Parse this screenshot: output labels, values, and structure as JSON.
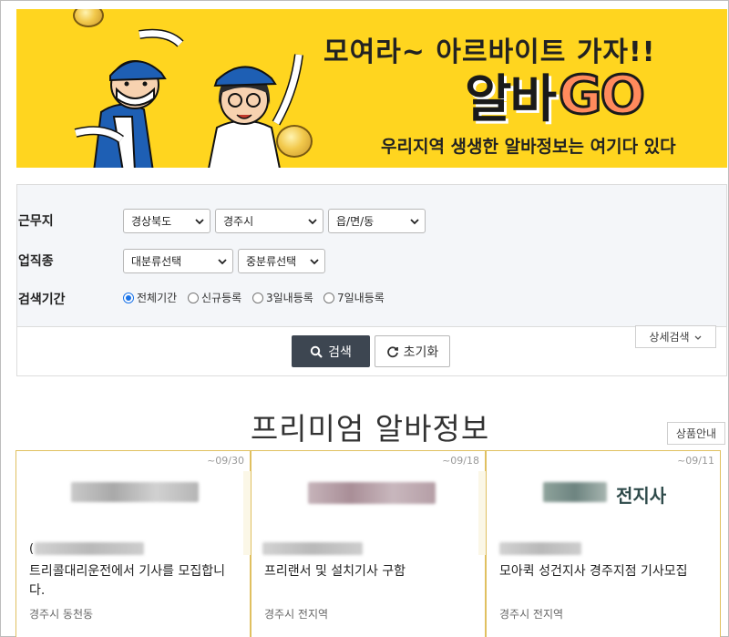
{
  "banner": {
    "headline": "모여라~ 아르바이트 가자!!",
    "logo_part1": "알바",
    "logo_part2": "GO",
    "subline": "우리지역 생생한 알바정보는 여기다 있다",
    "colors": {
      "background": "#ffd51f",
      "logo_accent": "#ff8a5c"
    }
  },
  "search": {
    "labels": {
      "location": "근무지",
      "job_type": "업직종",
      "period": "검색기간"
    },
    "location_selects": [
      "경상북도",
      "경주시",
      "읍/면/동"
    ],
    "job_selects": [
      "대분류선택",
      "중분류선택"
    ],
    "period_options": [
      {
        "label": "전체기간",
        "checked": true
      },
      {
        "label": "신규등록",
        "checked": false
      },
      {
        "label": "3일내등록",
        "checked": false
      },
      {
        "label": "7일내등록",
        "checked": false
      }
    ],
    "detail_button": "상세검색",
    "search_button": "검색",
    "reset_button": "초기화",
    "icons": {
      "search": "magnifier-icon",
      "reset": "refresh-icon",
      "detail": "chevron-down-icon"
    }
  },
  "premium": {
    "title": "프리미엄 알바정보",
    "product_info_button": "상품안내",
    "cards": [
      {
        "date": "~09/30",
        "title": "트리콜대리운전에서 기사를 모집합니다.",
        "location": "경주시 동천동",
        "company_prefix": "("
      },
      {
        "date": "~09/18",
        "title": "프리랜서 및 설치기사 구함",
        "location": "경주시 전지역",
        "company_prefix": ""
      },
      {
        "date": "~09/11",
        "title": "모아퀵 성건지사 경주지점 기사모집",
        "location": "경주시 전지역",
        "company_prefix": "",
        "logo_text": "전지사"
      }
    ]
  }
}
